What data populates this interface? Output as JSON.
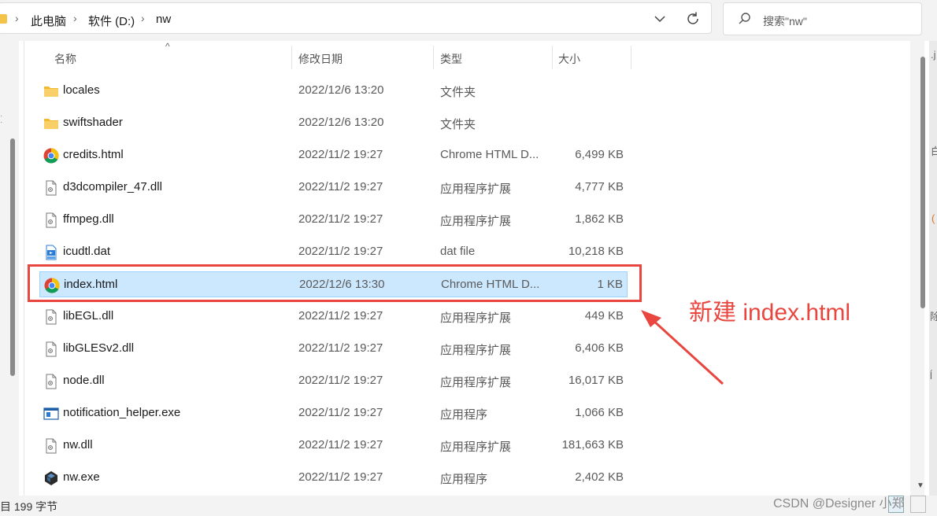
{
  "address_bar": {
    "breadcrumbs": [
      "此电脑",
      "软件 (D:)",
      "nw"
    ]
  },
  "search": {
    "placeholder": "搜索\"nw\""
  },
  "columns": {
    "name": "名称",
    "date": "修改日期",
    "type": "类型",
    "size": "大小"
  },
  "files": [
    {
      "name": "locales",
      "date": "2022/12/6 13:20",
      "type": "文件夹",
      "size": "",
      "icon": "folder-icon"
    },
    {
      "name": "swiftshader",
      "date": "2022/12/6 13:20",
      "type": "文件夹",
      "size": "",
      "icon": "folder-icon"
    },
    {
      "name": "credits.html",
      "date": "2022/11/2 19:27",
      "type": "Chrome HTML D...",
      "size": "6,499 KB",
      "icon": "chrome-icon"
    },
    {
      "name": "d3dcompiler_47.dll",
      "date": "2022/11/2 19:27",
      "type": "应用程序扩展",
      "size": "4,777 KB",
      "icon": "dll-file-icon"
    },
    {
      "name": "ffmpeg.dll",
      "date": "2022/11/2 19:27",
      "type": "应用程序扩展",
      "size": "1,862 KB",
      "icon": "dll-file-icon"
    },
    {
      "name": "icudtl.dat",
      "date": "2022/11/2 19:27",
      "type": "dat file",
      "size": "10,218 KB",
      "icon": "dat-file-icon"
    },
    {
      "name": "index.html",
      "date": "2022/12/6 13:30",
      "type": "Chrome HTML D...",
      "size": "1 KB",
      "icon": "chrome-icon",
      "selected": true
    },
    {
      "name": "libEGL.dll",
      "date": "2022/11/2 19:27",
      "type": "应用程序扩展",
      "size": "449 KB",
      "icon": "dll-file-icon"
    },
    {
      "name": "libGLESv2.dll",
      "date": "2022/11/2 19:27",
      "type": "应用程序扩展",
      "size": "6,406 KB",
      "icon": "dll-file-icon"
    },
    {
      "name": "node.dll",
      "date": "2022/11/2 19:27",
      "type": "应用程序扩展",
      "size": "16,017 KB",
      "icon": "dll-file-icon"
    },
    {
      "name": "notification_helper.exe",
      "date": "2022/11/2 19:27",
      "type": "应用程序",
      "size": "1,066 KB",
      "icon": "exe-app-icon"
    },
    {
      "name": "nw.dll",
      "date": "2022/11/2 19:27",
      "type": "应用程序扩展",
      "size": "181,663 KB",
      "icon": "dll-file-icon"
    },
    {
      "name": "nw.exe",
      "date": "2022/11/2 19:27",
      "type": "应用程序",
      "size": "2,402 KB",
      "icon": "nw-app-icon"
    }
  ],
  "status_bar": {
    "text": "目 199 字节"
  },
  "annotation": {
    "text": "新建 index.html"
  },
  "watermark": "CSDN @Designer 小郑",
  "colors": {
    "selection_bg": "#cce8ff",
    "selection_border": "#99d1ff",
    "annotation_red": "#e8463f"
  }
}
